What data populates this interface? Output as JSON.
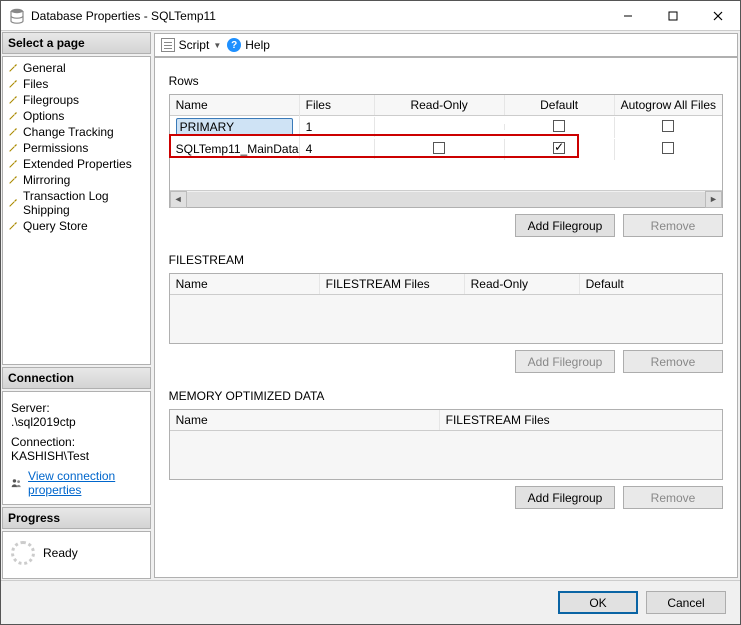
{
  "window": {
    "title": "Database Properties - SQLTemp11"
  },
  "left": {
    "select_page": "Select a page",
    "pages": [
      "General",
      "Files",
      "Filegroups",
      "Options",
      "Change Tracking",
      "Permissions",
      "Extended Properties",
      "Mirroring",
      "Transaction Log Shipping",
      "Query Store"
    ],
    "connection_head": "Connection",
    "server_label": "Server:",
    "server": ".\\sql2019ctp",
    "connection_label": "Connection:",
    "connection": "KASHISH\\Test",
    "view_conn": "View connection properties",
    "progress_head": "Progress",
    "progress_status": "Ready"
  },
  "toolbar": {
    "script": "Script",
    "help": "Help"
  },
  "rows": {
    "title": "Rows",
    "headers": {
      "name": "Name",
      "files": "Files",
      "readonly": "Read-Only",
      "default": "Default",
      "autogrow": "Autogrow All Files"
    },
    "data": [
      {
        "name": "PRIMARY",
        "files": "1",
        "readonly": null,
        "default": false,
        "autogrow": false
      },
      {
        "name": "SQLTemp11_MainData",
        "files": "4",
        "readonly": false,
        "default": true,
        "autogrow": false
      }
    ],
    "add": "Add Filegroup",
    "remove": "Remove"
  },
  "filestream": {
    "title": "FILESTREAM",
    "headers": {
      "name": "Name",
      "files": "FILESTREAM Files",
      "readonly": "Read-Only",
      "default": "Default"
    },
    "add": "Add Filegroup",
    "remove": "Remove"
  },
  "memopt": {
    "title": "MEMORY OPTIMIZED DATA",
    "headers": {
      "name": "Name",
      "files": "FILESTREAM Files"
    },
    "add": "Add Filegroup",
    "remove": "Remove"
  },
  "footer": {
    "ok": "OK",
    "cancel": "Cancel"
  }
}
